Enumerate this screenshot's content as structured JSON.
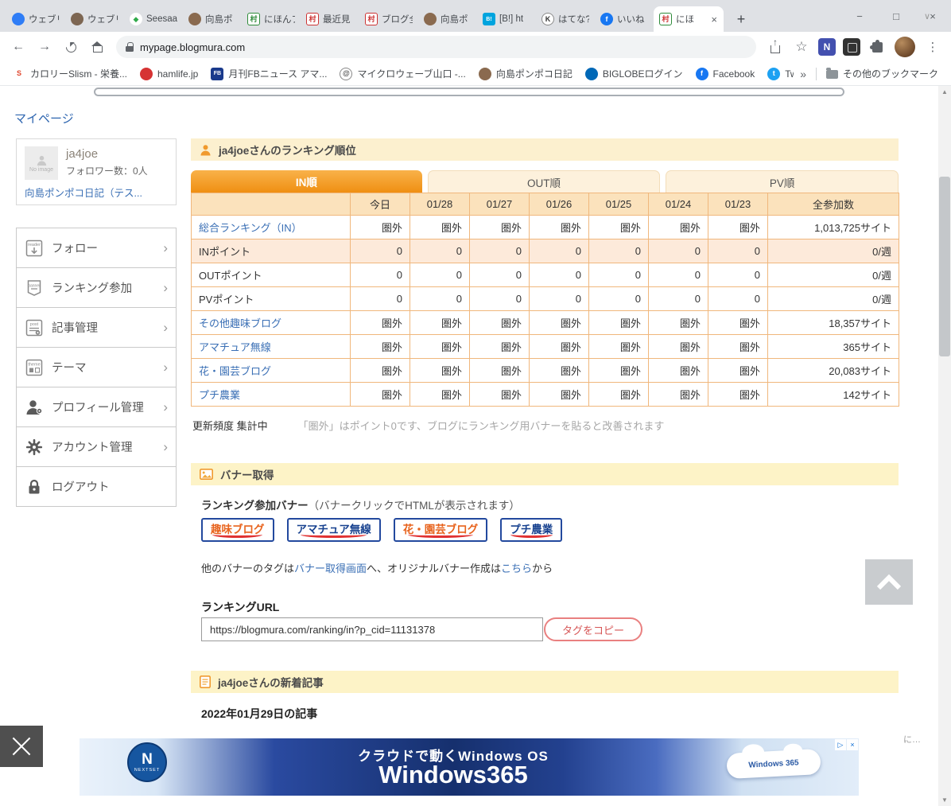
{
  "browser": {
    "tabs": [
      {
        "label": "ウェブリ",
        "icon": "webry-favicon",
        "icon_glyph": "",
        "icon_bg": "#2f7df6",
        "icon_shape": "circle"
      },
      {
        "label": "ウェブリ",
        "icon": "site-avatar-favicon",
        "icon_glyph": "",
        "icon_bg": "#7d6652",
        "icon_shape": "circle"
      },
      {
        "label": "Seesaa",
        "icon": "seesaa-favicon",
        "icon_glyph": "◆",
        "icon_bg": "#ffffff",
        "icon_fg": "#2faa4a",
        "icon_shape": "circle"
      },
      {
        "label": "向島ポ",
        "icon": "avatar-favicon",
        "icon_glyph": "",
        "icon_bg": "#8a6a4f",
        "icon_shape": "circle"
      },
      {
        "label": "にほんブ",
        "icon": "blogmura-favicon",
        "icon_glyph": "村",
        "icon_bg": "#ffffff",
        "icon_fg": "#2e8b3a",
        "icon_border": "#2e8b3a",
        "icon_shape": "square"
      },
      {
        "label": "最近見",
        "icon": "blogmura-favicon",
        "icon_glyph": "村",
        "icon_bg": "#ffffff",
        "icon_fg": "#cc3333",
        "icon_border": "#cc3333",
        "icon_shape": "square"
      },
      {
        "label": "ブログ全",
        "icon": "blogmura-favicon",
        "icon_glyph": "村",
        "icon_bg": "#ffffff",
        "icon_fg": "#cc3333",
        "icon_border": "#cc3333",
        "icon_shape": "square"
      },
      {
        "label": "向島ポ",
        "icon": "avatar-favicon",
        "icon_glyph": "",
        "icon_bg": "#8a6a4f",
        "icon_shape": "circle"
      },
      {
        "label": "[B!] ht",
        "icon": "hatena-bookmark-favicon",
        "icon_glyph": "B!",
        "icon_bg": "#00a4de",
        "icon_fg": "#ffffff",
        "icon_shape": "square"
      },
      {
        "label": "はてな?",
        "icon": "k-favicon",
        "icon_glyph": "K",
        "icon_bg": "#ffffff",
        "icon_fg": "#333333",
        "icon_border": "#888888",
        "icon_shape": "circle"
      },
      {
        "label": "いいね",
        "icon": "facebook-favicon",
        "icon_glyph": "f",
        "icon_bg": "#1877f2",
        "icon_fg": "#ffffff",
        "icon_shape": "circle"
      },
      {
        "label": "にほ",
        "icon": "blogmura-favicon",
        "icon_glyph": "村",
        "icon_bg": "#ffffff",
        "icon_fg": "#cc3333",
        "icon_border": "#2e8b3a",
        "icon_shape": "square",
        "active": true
      }
    ],
    "new_tab": "+",
    "window_controls": {
      "tab_chevron": "∨",
      "minimize": "−",
      "maximize": "□",
      "close": "×"
    },
    "address": "mypage.blogmura.com",
    "bookmarks": [
      {
        "label": "カロリーSlism - 栄養...",
        "icon": "slism-favicon",
        "icon_glyph": "S",
        "icon_bg": "transparent",
        "icon_fg": "#e0452c",
        "icon_shape": "circle"
      },
      {
        "label": "hamlife.jp",
        "icon": "hamlife-favicon",
        "icon_glyph": "",
        "icon_bg": "#d63333",
        "icon_shape": "circle"
      },
      {
        "label": "月刊FBニュース アマ...",
        "icon": "fbnews-favicon",
        "icon_glyph": "FB",
        "icon_bg": "#1a3a8c",
        "icon_fg": "#ffffff",
        "icon_shape": "square"
      },
      {
        "label": "マイクロウェーブ山口 -...",
        "icon": "microwave-favicon",
        "icon_glyph": "@",
        "icon_bg": "#ffffff",
        "icon_fg": "#555555",
        "icon_border": "#888888",
        "icon_shape": "circle"
      },
      {
        "label": "向島ポンポコ日記",
        "icon": "avatar-favicon",
        "icon_glyph": "",
        "icon_bg": "#8a6a4f",
        "icon_shape": "circle"
      },
      {
        "label": "BIGLOBEログイン",
        "icon": "biglobe-favicon",
        "icon_glyph": "",
        "icon_bg": "#0068b7",
        "icon_shape": "circle"
      },
      {
        "label": "Facebook",
        "icon": "facebook-favicon",
        "icon_glyph": "f",
        "icon_bg": "#1877f2",
        "icon_fg": "#ffffff",
        "icon_shape": "circle"
      },
      {
        "label": "Twitter",
        "icon": "twitter-favicon",
        "icon_glyph": "t",
        "icon_bg": "#1da1f2",
        "icon_fg": "#ffffff",
        "icon_shape": "circle"
      }
    ],
    "bookmarks_overflow": "»",
    "other_bookmarks": "その他のブックマーク"
  },
  "page": {
    "title": "マイページ",
    "profile": {
      "no_image_label": "No image",
      "username": "ja4joe",
      "followers": "フォロワー数：0人",
      "blog_link": "向島ポンポコ日記（テス..."
    },
    "menu": [
      {
        "label": "フォロー",
        "icon": "follow-reader-icon",
        "chevron": true
      },
      {
        "label": "ランキング参加",
        "icon": "ranking-banner-icon",
        "chevron": true
      },
      {
        "label": "記事管理",
        "icon": "post-manage-icon",
        "chevron": true
      },
      {
        "label": "テーマ",
        "icon": "theme-icon",
        "chevron": true
      },
      {
        "label": "プロフィール管理",
        "icon": "profile-manage-icon",
        "chevron": true
      },
      {
        "label": "アカウント管理",
        "icon": "account-gear-icon",
        "chevron": true
      },
      {
        "label": "ログアウト",
        "icon": "logout-lock-icon",
        "chevron": false
      }
    ],
    "ranking": {
      "header": "ja4joeさんのランキング順位",
      "tabs": [
        {
          "label": "IN順",
          "active": true
        },
        {
          "label": "OUT順",
          "active": false
        },
        {
          "label": "PV順",
          "active": false
        }
      ],
      "columns": [
        "",
        "今日",
        "01/28",
        "01/27",
        "01/26",
        "01/25",
        "01/24",
        "01/23",
        "全参加数"
      ],
      "rows": [
        {
          "label": "総合ランキング（IN）",
          "link": true,
          "highlight": false,
          "values": [
            "圏外",
            "圏外",
            "圏外",
            "圏外",
            "圏外",
            "圏外",
            "圏外"
          ],
          "total": "1,013,725サイト"
        },
        {
          "label": "INポイント",
          "link": false,
          "highlight": true,
          "values": [
            "0",
            "0",
            "0",
            "0",
            "0",
            "0",
            "0"
          ],
          "total": "0/週"
        },
        {
          "label": "OUTポイント",
          "link": false,
          "highlight": false,
          "values": [
            "0",
            "0",
            "0",
            "0",
            "0",
            "0",
            "0"
          ],
          "total": "0/週"
        },
        {
          "label": "PVポイント",
          "link": false,
          "highlight": false,
          "values": [
            "0",
            "0",
            "0",
            "0",
            "0",
            "0",
            "0"
          ],
          "total": "0/週"
        },
        {
          "label": "その他趣味ブログ",
          "link": true,
          "highlight": false,
          "values": [
            "圏外",
            "圏外",
            "圏外",
            "圏外",
            "圏外",
            "圏外",
            "圏外"
          ],
          "total": "18,357サイト"
        },
        {
          "label": "アマチュア無線",
          "link": true,
          "highlight": false,
          "values": [
            "圏外",
            "圏外",
            "圏外",
            "圏外",
            "圏外",
            "圏外",
            "圏外"
          ],
          "total": "365サイト"
        },
        {
          "label": "花・園芸ブログ",
          "link": true,
          "highlight": false,
          "values": [
            "圏外",
            "圏外",
            "圏外",
            "圏外",
            "圏外",
            "圏外",
            "圏外"
          ],
          "total": "20,083サイト"
        },
        {
          "label": "プチ農業",
          "link": true,
          "highlight": false,
          "values": [
            "圏外",
            "圏外",
            "圏外",
            "圏外",
            "圏外",
            "圏外",
            "圏外"
          ],
          "total": "142サイト"
        }
      ],
      "update_status": "更新頻度 集計中",
      "note": "「圏外」はポイント0です、ブログにランキング用バナーを貼ると改善されます"
    },
    "banner_section": {
      "header": "バナー取得",
      "lead_label": "ランキング参加バナー",
      "lead_note": "（バナークリックでHTMLが表示されます）",
      "banners": [
        {
          "label": "趣味ブログ",
          "color": "#e8641e"
        },
        {
          "label": "アマチュア無線",
          "color": "#17418f"
        },
        {
          "label": "花・園芸ブログ",
          "color": "#e8641e"
        },
        {
          "label": "プチ農業",
          "color": "#17418f"
        }
      ],
      "tag_note_parts": [
        "他のバナーのタグは",
        "バナー取得画面",
        "へ、オリジナルバナー作成は",
        "こちら",
        "から"
      ],
      "url_label": "ランキングURL",
      "ranking_url": "https://blogmura.com/ranking/in?p_cid=11131378",
      "copy_button": "タグをコピー"
    },
    "articles_section": {
      "header": "ja4joeさんの新着記事",
      "date_heading": "2022年01月29日の記事"
    },
    "fragment": "に…"
  },
  "ad": {
    "headline": "クラウドで動くWindows OS",
    "product": "Windows365",
    "logo_letter": "N",
    "logo_text": "NEXTSET",
    "cloud_text": "Windows 365"
  }
}
